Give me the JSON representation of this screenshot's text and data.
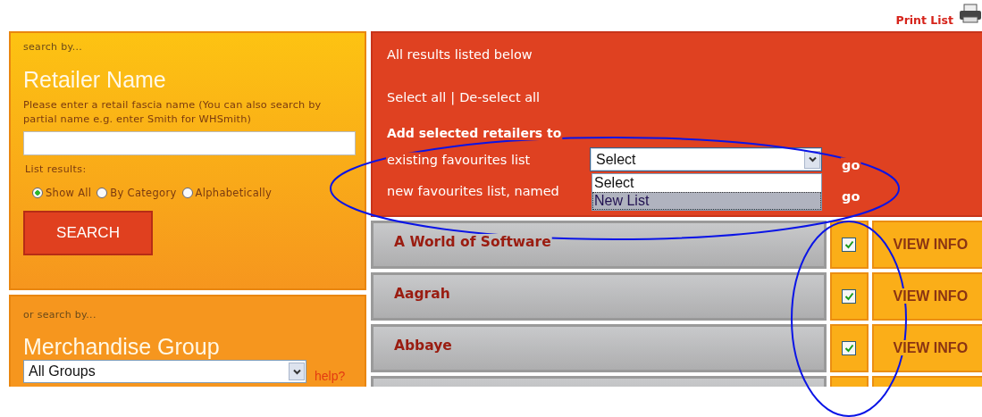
{
  "print_link": {
    "label": "Print List"
  },
  "retailer_search": {
    "kicker": "search by...",
    "heading": "Retailer Name",
    "hint": "Please enter a retail fascia name (You can also search by partial name e.g. enter Smith for WHSmith)",
    "list_label": "List results:",
    "options": [
      {
        "label": "Show All",
        "selected": true
      },
      {
        "label": "By Category",
        "selected": false
      },
      {
        "label": "Alphabetically",
        "selected": false
      }
    ],
    "button": "SEARCH"
  },
  "group_search": {
    "kicker": "or search by...",
    "heading": "Merchandise Group",
    "select_value": "All Groups",
    "help": "help?"
  },
  "results_panel": {
    "summary": "All results listed below",
    "select_all": "Select all",
    "separator": "|",
    "deselect_all": "De-select all",
    "add_heading": "Add selected retailers to",
    "existing_label": "existing favourites list",
    "existing_select": {
      "value": "Select",
      "expanded": true,
      "options": [
        {
          "label": "Select",
          "highlighted": false
        },
        {
          "label": "New List",
          "highlighted": true
        }
      ]
    },
    "existing_go": "go",
    "new_label": "new favourites list, named",
    "new_go": "go"
  },
  "results": [
    {
      "kind": "retailer",
      "name": "A World of Software",
      "checked": true,
      "action": "VIEW INFO"
    },
    {
      "kind": "retailer",
      "name": "Aagrah",
      "checked": true,
      "action": "VIEW INFO"
    },
    {
      "kind": "retailer",
      "name": "Abbaye",
      "checked": true,
      "action": "VIEW INFO"
    },
    {
      "kind": "cut_off"
    }
  ],
  "annotations": [
    {
      "kind": "ellipse"
    },
    {
      "kind": "ellipse"
    }
  ]
}
